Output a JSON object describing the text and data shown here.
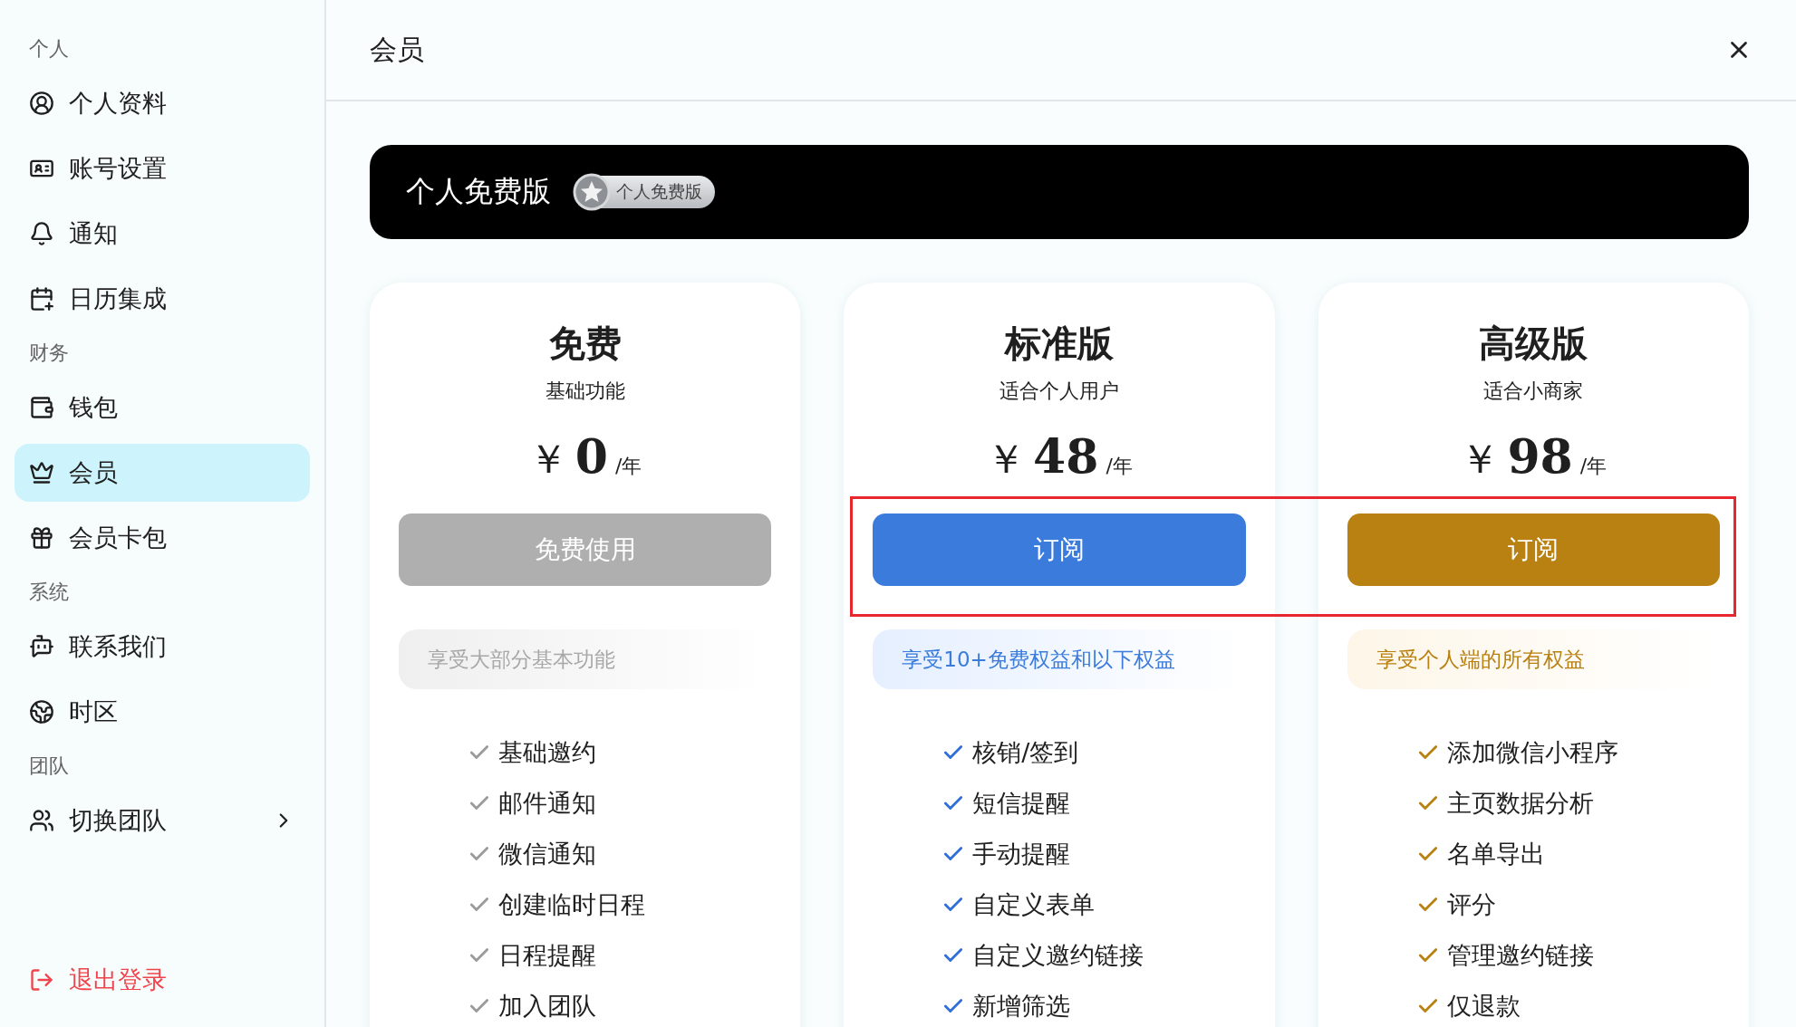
{
  "sidebar": {
    "sections": [
      {
        "title": "个人",
        "items": [
          {
            "label": "个人资料",
            "kind": "profile",
            "selected": false
          },
          {
            "label": "账号设置",
            "kind": "idcard",
            "selected": false
          },
          {
            "label": "通知",
            "kind": "bell",
            "selected": false
          },
          {
            "label": "日历集成",
            "kind": "calendar",
            "selected": false
          }
        ]
      },
      {
        "title": "财务",
        "items": [
          {
            "label": "钱包",
            "kind": "wallet",
            "selected": false
          },
          {
            "label": "会员",
            "kind": "crown",
            "selected": true
          },
          {
            "label": "会员卡包",
            "kind": "gift",
            "selected": false
          }
        ]
      },
      {
        "title": "系统",
        "items": [
          {
            "label": "联系我们",
            "kind": "chat",
            "selected": false
          },
          {
            "label": "时区",
            "kind": "globe",
            "selected": false
          }
        ]
      },
      {
        "title": "团队",
        "items": [
          {
            "label": "切换团队",
            "kind": "users",
            "selected": false,
            "has_submenu": true
          }
        ]
      }
    ],
    "logout": "退出登录"
  },
  "header": {
    "title": "会员"
  },
  "banner": {
    "title": "个人免费版",
    "badge": "个人免费版"
  },
  "plans": [
    {
      "kind": "free",
      "name": "免费",
      "subtitle": "基础功能",
      "currency": "￥",
      "amount": "0",
      "unit": "/年",
      "button": "免费使用",
      "benefit": "享受大部分基本功能",
      "features": [
        "基础邀约",
        "邮件通知",
        "微信通知",
        "创建临时日程",
        "日程提醒",
        "加入团队"
      ]
    },
    {
      "kind": "standard",
      "name": "标准版",
      "subtitle": "适合个人用户",
      "currency": "￥",
      "amount": "48",
      "unit": "/年",
      "button": "订阅",
      "benefit": "享受10+免费权益和以下权益",
      "features": [
        "核销/签到",
        "短信提醒",
        "手动提醒",
        "自定义表单",
        "自定义邀约链接",
        "新增筛选"
      ]
    },
    {
      "kind": "premium",
      "name": "高级版",
      "subtitle": "适合小商家",
      "currency": "￥",
      "amount": "98",
      "unit": "/年",
      "button": "订阅",
      "benefit": "享受个人端的所有权益",
      "features": [
        "添加微信小程序",
        "主页数据分析",
        "名单导出",
        "评分",
        "管理邀约链接",
        "仅退款"
      ]
    }
  ]
}
